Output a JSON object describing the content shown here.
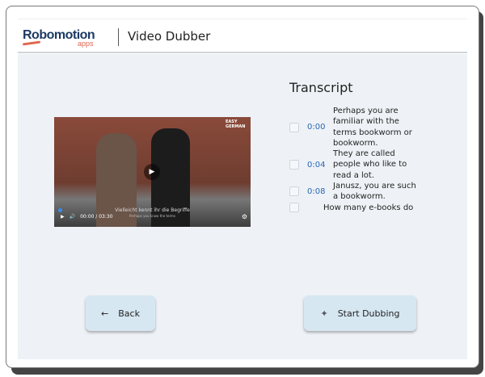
{
  "header": {
    "logo": "Robomotion",
    "logo_sub": "apps",
    "title": "Video Dubber"
  },
  "video": {
    "subtitle_de": "Vielleicht kennt ihr die Begriffe",
    "subtitle_en": "Perhaps you know the terms",
    "time": "00:00 / 03:30",
    "watermark": "EASY GERMAN"
  },
  "transcript": {
    "title": "Transcript",
    "items": [
      {
        "time": "0:00",
        "text": "Perhaps you are familiar with the terms bookworm or bookworm."
      },
      {
        "time": "0:04",
        "text": "They are called people who like to read a lot."
      },
      {
        "time": "0:08",
        "text": "Janusz, you are such a bookworm."
      },
      {
        "time": "",
        "text": "How many e-books do"
      }
    ]
  },
  "buttons": {
    "back": "Back",
    "start": "Start Dubbing"
  }
}
